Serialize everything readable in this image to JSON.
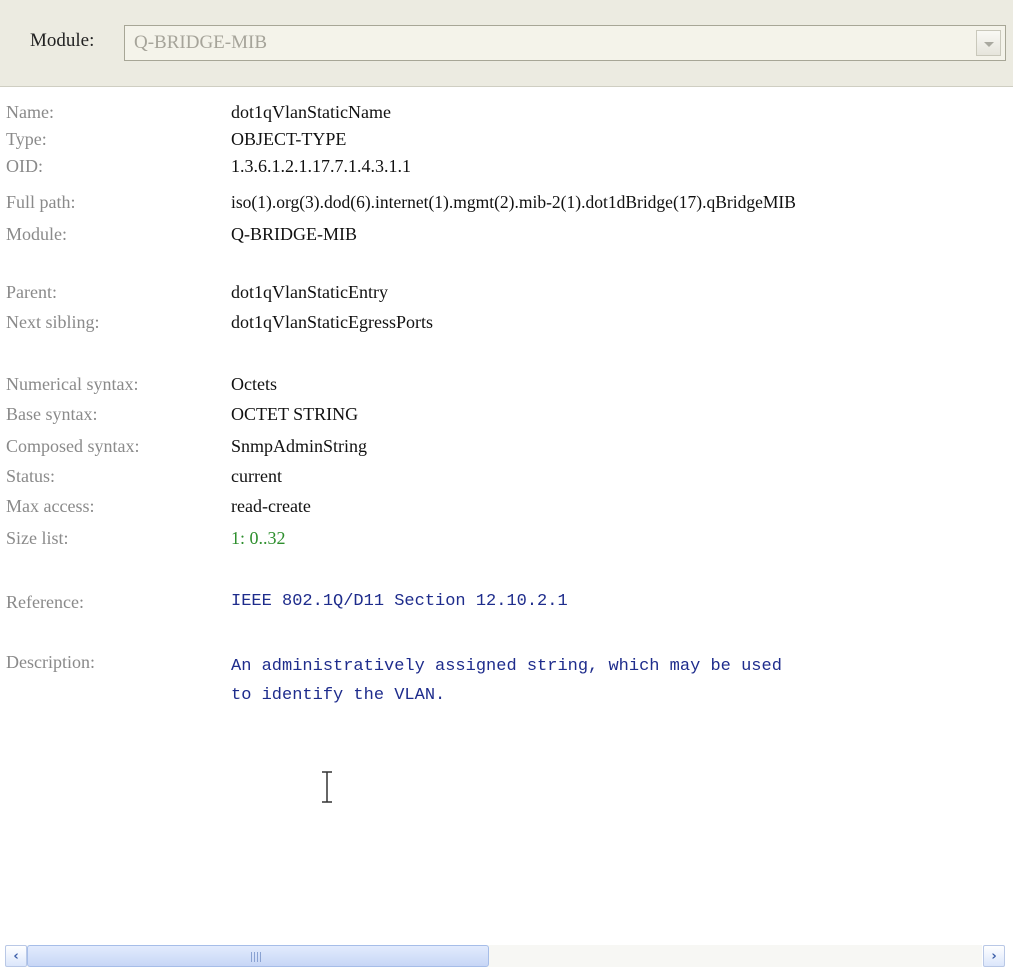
{
  "header": {
    "module_label": "Module:",
    "module_value": "Q-BRIDGE-MIB"
  },
  "details": {
    "name": {
      "label": "Name:",
      "value": "dot1qVlanStaticName"
    },
    "type": {
      "label": "Type:",
      "value": "OBJECT-TYPE"
    },
    "oid": {
      "label": "OID:",
      "value": "1.3.6.1.2.1.17.7.1.4.3.1.1"
    },
    "full_path": {
      "label": "Full path:",
      "value": "iso(1).org(3).dod(6).internet(1).mgmt(2).mib-2(1).dot1dBridge(17).qBridgeMIB"
    },
    "module": {
      "label": "Module:",
      "value": "Q-BRIDGE-MIB"
    },
    "parent": {
      "label": "Parent:",
      "value": "dot1qVlanStaticEntry"
    },
    "next_sibling": {
      "label": "Next sibling:",
      "value": "dot1qVlanStaticEgressPorts"
    },
    "numerical_syntax": {
      "label": "Numerical syntax:",
      "value": "Octets"
    },
    "base_syntax": {
      "label": "Base syntax:",
      "value": "OCTET STRING"
    },
    "composed_syntax": {
      "label": "Composed syntax:",
      "value": "SnmpAdminString"
    },
    "status": {
      "label": "Status:",
      "value": "current"
    },
    "max_access": {
      "label": "Max access:",
      "value": "read-create"
    },
    "size_list": {
      "label": "Size list:",
      "value": "1: 0..32"
    },
    "reference": {
      "label": "Reference:",
      "value": "IEEE 802.1Q/D11 Section 12.10.2.1"
    },
    "description": {
      "label": "Description:",
      "value": "An administratively assigned string, which may be used\nto identify the VLAN."
    }
  },
  "colors": {
    "label": "#8a8a8a",
    "value": "#111111",
    "size_list": "#2e8f2e",
    "reference_description": "#1e2c8c",
    "header_bg": "#ecebe1"
  },
  "scrollbar": {
    "left_icon": "‹",
    "right_icon": "›",
    "position": 0
  }
}
